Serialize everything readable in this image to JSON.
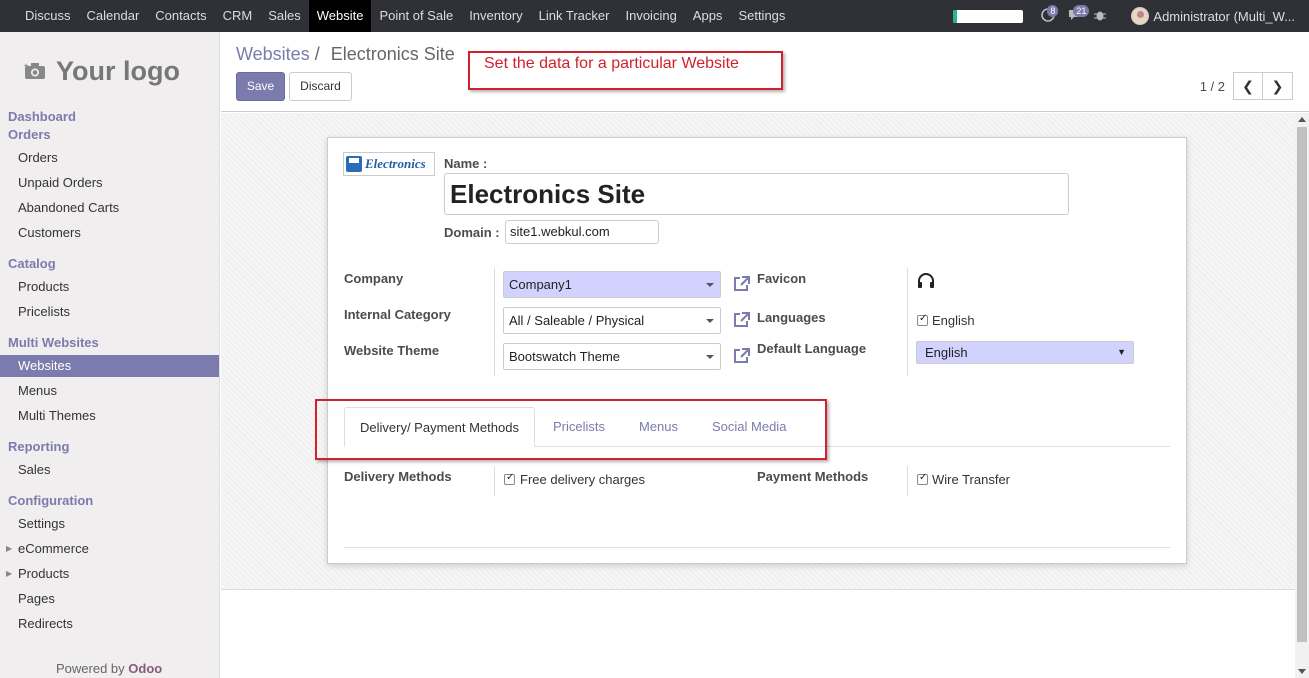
{
  "topbar": {
    "menu": [
      "Discuss",
      "Calendar",
      "Contacts",
      "CRM",
      "Sales",
      "Website",
      "Point of Sale",
      "Inventory",
      "Link Tracker",
      "Invoicing",
      "Apps",
      "Settings"
    ],
    "active_menu": "Website",
    "progress": 0.05,
    "messages_count": "8",
    "activities_count": "21",
    "user": "Administrator (Multi_W..."
  },
  "sidebar": {
    "logo_text": "Your logo",
    "sections": {
      "dashboard": "Dashboard",
      "orders": "Orders",
      "catalog": "Catalog",
      "multi_websites": "Multi Websites",
      "reporting": "Reporting",
      "configuration": "Configuration"
    },
    "items": {
      "orders": "Orders",
      "unpaid_orders": "Unpaid Orders",
      "abandoned_carts": "Abandoned Carts",
      "customers": "Customers",
      "products": "Products",
      "pricelists": "Pricelists",
      "websites": "Websites",
      "menus": "Menus",
      "multi_themes": "Multi Themes",
      "sales": "Sales",
      "settings": "Settings",
      "ecommerce": "eCommerce",
      "config_products": "Products",
      "pages": "Pages",
      "redirects": "Redirects"
    },
    "powered_by": "Powered by",
    "powered_brand": "Odoo"
  },
  "control": {
    "breadcrumb_parent": "Websites",
    "breadcrumb_sep": "/",
    "breadcrumb_current": "Electronics Site",
    "save_label": "Save",
    "discard_label": "Discard",
    "pager": "1 / 2"
  },
  "callout": "Set the data for a particular Website",
  "form": {
    "logo_text": "Electronics",
    "name_label": "Name :",
    "name_value": "Electronics Site",
    "domain_label": "Domain :",
    "domain_value": "site1.webkul.com",
    "company_label": "Company",
    "company_value": "Company1",
    "internal_category_label": "Internal Category",
    "internal_category_value": "All / Saleable / Physical",
    "theme_label": "Website Theme",
    "theme_value": "Bootswatch Theme",
    "favicon_label": "Favicon",
    "languages_label": "Languages",
    "languages_value": "English",
    "default_language_label": "Default Language",
    "default_language_value": "English"
  },
  "tabs": [
    "Delivery/ Payment Methods",
    "Pricelists",
    "Menus",
    "Social Media"
  ],
  "delivery": {
    "delivery_label": "Delivery Methods",
    "delivery_value": "Free delivery charges",
    "payment_label": "Payment Methods",
    "payment_value": "Wire Transfer"
  },
  "colors": {
    "accent": "#7c7bad",
    "topbar": "#2f3136",
    "callout_red": "#d2212e"
  }
}
